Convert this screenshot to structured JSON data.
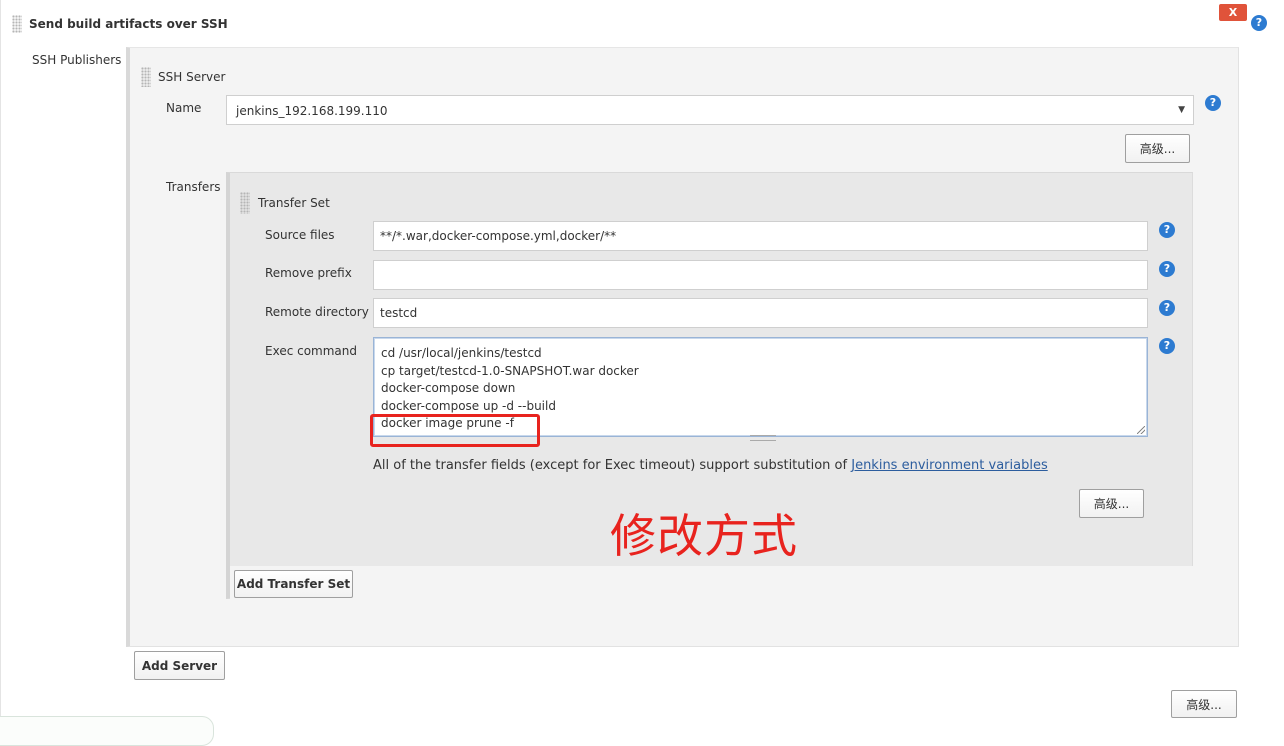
{
  "section": {
    "title": "Send build artifacts over SSH",
    "close_label": "X"
  },
  "publishers": {
    "label": "SSH Publishers",
    "server": {
      "header": "SSH Server",
      "name_label": "Name",
      "name_value": "jenkins_192.168.199.110",
      "advanced_label": "高级..."
    },
    "transfers_label": "Transfers",
    "transfer_set": {
      "header": "Transfer Set",
      "source_files_label": "Source files",
      "source_files_value": "**/*.war,docker-compose.yml,docker/**",
      "remove_prefix_label": "Remove prefix",
      "remove_prefix_value": "",
      "remote_directory_label": "Remote directory",
      "remote_directory_value": "testcd",
      "exec_command_label": "Exec command",
      "exec_command_lines": [
        "cd /usr/local/jenkins/testcd",
        "cp target/testcd-1.0-SNAPSHOT.war docker",
        "docker-compose down",
        "docker-compose up -d --build",
        "docker image prune -f"
      ],
      "hint_prefix": "All of the transfer fields (except for Exec timeout) support substitution of ",
      "hint_link": "Jenkins environment variables",
      "advanced_label": "高级..."
    },
    "add_transfer_set_label": "Add Transfer Set",
    "add_server_label": "Add Server"
  },
  "footer": {
    "advanced_label": "高级..."
  },
  "annotation": {
    "text": "修改方式",
    "color": "#e8231e"
  },
  "colors": {
    "help": "#2d7bd1",
    "link": "#2c5d9e",
    "close": "#e0533a"
  },
  "icons": {
    "help": "?"
  }
}
